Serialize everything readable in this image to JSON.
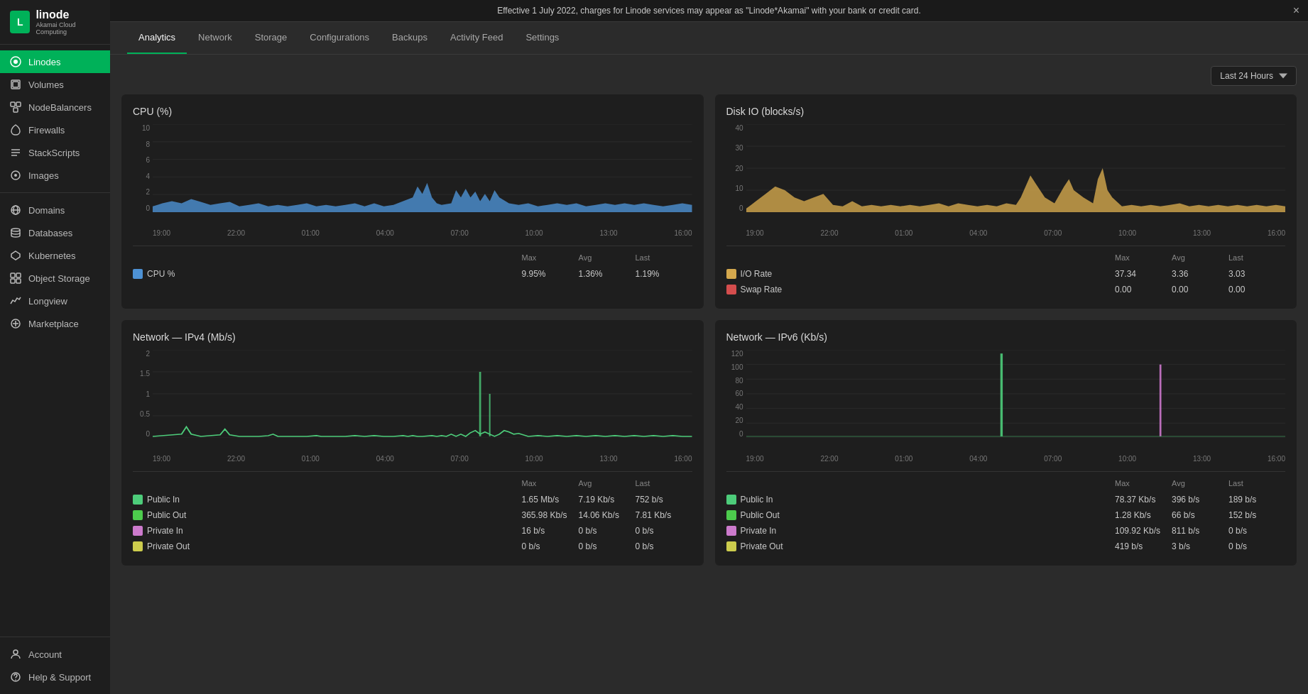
{
  "announcement": {
    "text": "Effective 1 July 2022, charges for Linode services may appear as \"Linode*Akamai\" with your bank or credit card.",
    "close_label": "×"
  },
  "sidebar": {
    "logo": {
      "text": "linode",
      "subtext": "Akamai Cloud Computing"
    },
    "primary_items": [
      {
        "id": "linodes",
        "label": "Linodes",
        "icon": "⊕",
        "active": true
      },
      {
        "id": "volumes",
        "label": "Volumes",
        "icon": "▣"
      },
      {
        "id": "nodebalancers",
        "label": "NodeBalancers",
        "icon": "⊞"
      },
      {
        "id": "firewalls",
        "label": "Firewalls",
        "icon": "🔥"
      },
      {
        "id": "stackscripts",
        "label": "StackScripts",
        "icon": "≡"
      },
      {
        "id": "images",
        "label": "Images",
        "icon": "◉"
      }
    ],
    "secondary_items": [
      {
        "id": "domains",
        "label": "Domains",
        "icon": "🌐"
      },
      {
        "id": "databases",
        "label": "Databases",
        "icon": "▤"
      },
      {
        "id": "kubernetes",
        "label": "Kubernetes",
        "icon": "⚙"
      },
      {
        "id": "object-storage",
        "label": "Object Storage",
        "icon": "▦"
      },
      {
        "id": "longview",
        "label": "Longview",
        "icon": "∿"
      },
      {
        "id": "marketplace",
        "label": "Marketplace",
        "icon": "⊕"
      }
    ],
    "bottom_items": [
      {
        "id": "account",
        "label": "Account",
        "icon": "👤"
      },
      {
        "id": "help-support",
        "label": "Help & Support",
        "icon": "❓"
      }
    ]
  },
  "tabs": [
    {
      "id": "analytics",
      "label": "Analytics",
      "active": true
    },
    {
      "id": "network",
      "label": "Network"
    },
    {
      "id": "storage",
      "label": "Storage"
    },
    {
      "id": "configurations",
      "label": "Configurations"
    },
    {
      "id": "backups",
      "label": "Backups"
    },
    {
      "id": "activity-feed",
      "label": "Activity Feed"
    },
    {
      "id": "settings",
      "label": "Settings"
    }
  ],
  "time_selector": {
    "label": "Last 24 Hours"
  },
  "charts": {
    "cpu": {
      "title": "CPU (%)",
      "y_axis": [
        "10",
        "8",
        "6",
        "4",
        "2",
        "0"
      ],
      "x_axis": [
        "19:00",
        "22:00",
        "01:00",
        "04:00",
        "07:00",
        "10:00",
        "13:00",
        "16:00"
      ],
      "legend_headers": [
        "",
        "Max",
        "Avg",
        "Last"
      ],
      "legend_rows": [
        {
          "label": "CPU %",
          "color": "#4d91d4",
          "max": "9.95%",
          "avg": "1.36%",
          "last": "1.19%"
        }
      ]
    },
    "disk_io": {
      "title": "Disk IO (blocks/s)",
      "y_axis": [
        "40",
        "30",
        "20",
        "10",
        "0"
      ],
      "x_axis": [
        "19:00",
        "22:00",
        "01:00",
        "04:00",
        "07:00",
        "10:00",
        "13:00",
        "16:00"
      ],
      "legend_headers": [
        "",
        "Max",
        "Avg",
        "Last"
      ],
      "legend_rows": [
        {
          "label": "I/O Rate",
          "color": "#d4a84d",
          "max": "37.34",
          "avg": "3.36",
          "last": "3.03"
        },
        {
          "label": "Swap Rate",
          "color": "#d44d4d",
          "max": "0.00",
          "avg": "0.00",
          "last": "0.00"
        }
      ]
    },
    "network_ipv4": {
      "title": "Network — IPv4 (Mb/s)",
      "y_axis": [
        "2",
        "1.5",
        "1",
        "0.5",
        "0"
      ],
      "x_axis": [
        "19:00",
        "22:00",
        "01:00",
        "04:00",
        "07:00",
        "10:00",
        "13:00",
        "16:00"
      ],
      "legend_headers": [
        "",
        "Max",
        "Avg",
        "Last"
      ],
      "legend_rows": [
        {
          "label": "Public In",
          "color": "#4dcc7a",
          "max": "1.65 Mb/s",
          "avg": "7.19 Kb/s",
          "last": "752 b/s"
        },
        {
          "label": "Public Out",
          "color": "#4dcc4d",
          "max": "365.98 Kb/s",
          "avg": "14.06 Kb/s",
          "last": "7.81 Kb/s"
        },
        {
          "label": "Private In",
          "color": "#cc7acc",
          "max": "16 b/s",
          "avg": "0 b/s",
          "last": "0 b/s"
        },
        {
          "label": "Private Out",
          "color": "#cccc4d",
          "max": "0 b/s",
          "avg": "0 b/s",
          "last": "0 b/s"
        }
      ]
    },
    "network_ipv6": {
      "title": "Network — IPv6 (Kb/s)",
      "y_axis": [
        "120",
        "100",
        "80",
        "60",
        "40",
        "20",
        "0"
      ],
      "x_axis": [
        "19:00",
        "22:00",
        "01:00",
        "04:00",
        "07:00",
        "10:00",
        "13:00",
        "16:00"
      ],
      "legend_headers": [
        "",
        "Max",
        "Avg",
        "Last"
      ],
      "legend_rows": [
        {
          "label": "Public In",
          "color": "#4dcc7a",
          "max": "78.37 Kb/s",
          "avg": "396 b/s",
          "last": "189 b/s"
        },
        {
          "label": "Public Out",
          "color": "#4dcc4d",
          "max": "1.28 Kb/s",
          "avg": "66 b/s",
          "last": "152 b/s"
        },
        {
          "label": "Private In",
          "color": "#cc7acc",
          "max": "109.92 Kb/s",
          "avg": "811 b/s",
          "last": "0 b/s"
        },
        {
          "label": "Private Out",
          "color": "#cccc4d",
          "max": "419 b/s",
          "avg": "3 b/s",
          "last": "0 b/s"
        }
      ]
    }
  }
}
